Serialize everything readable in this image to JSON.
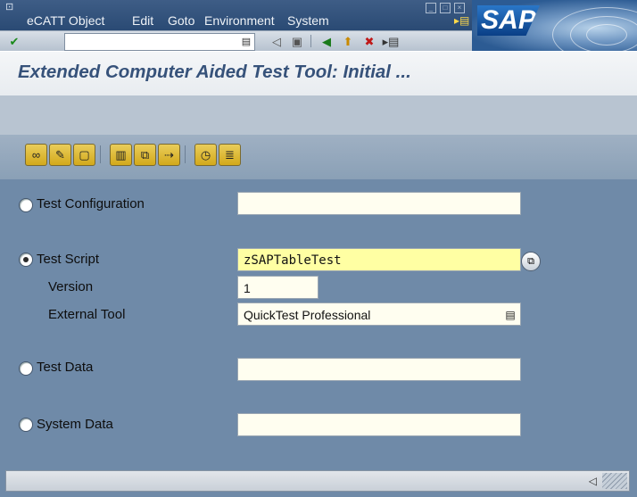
{
  "menubar": {
    "items": [
      {
        "label": "eCATT Object"
      },
      {
        "label": "Edit"
      },
      {
        "label": "Goto"
      },
      {
        "label": "Environment"
      },
      {
        "label": "System"
      }
    ]
  },
  "brand": {
    "logo_text": "SAP"
  },
  "toolbar": {
    "command_value": ""
  },
  "title": {
    "text": "Extended Computer Aided Test Tool: Initial ..."
  },
  "form": {
    "test_configuration": {
      "label": "Test Configuration",
      "value": "",
      "selected": false
    },
    "test_script": {
      "label": "Test Script",
      "value": "zSAPTableTest",
      "selected": true
    },
    "version": {
      "label": "Version",
      "value": "1"
    },
    "external_tool": {
      "label": "External Tool",
      "value": "QuickTest Professional"
    },
    "test_data": {
      "label": "Test Data",
      "value": "",
      "selected": false
    },
    "system_data": {
      "label": "System Data",
      "value": "",
      "selected": false
    }
  },
  "status": {
    "text": ""
  },
  "colors": {
    "accent": "#36527a",
    "field_active": "#ffffa3",
    "background": "#6f8aa8"
  }
}
